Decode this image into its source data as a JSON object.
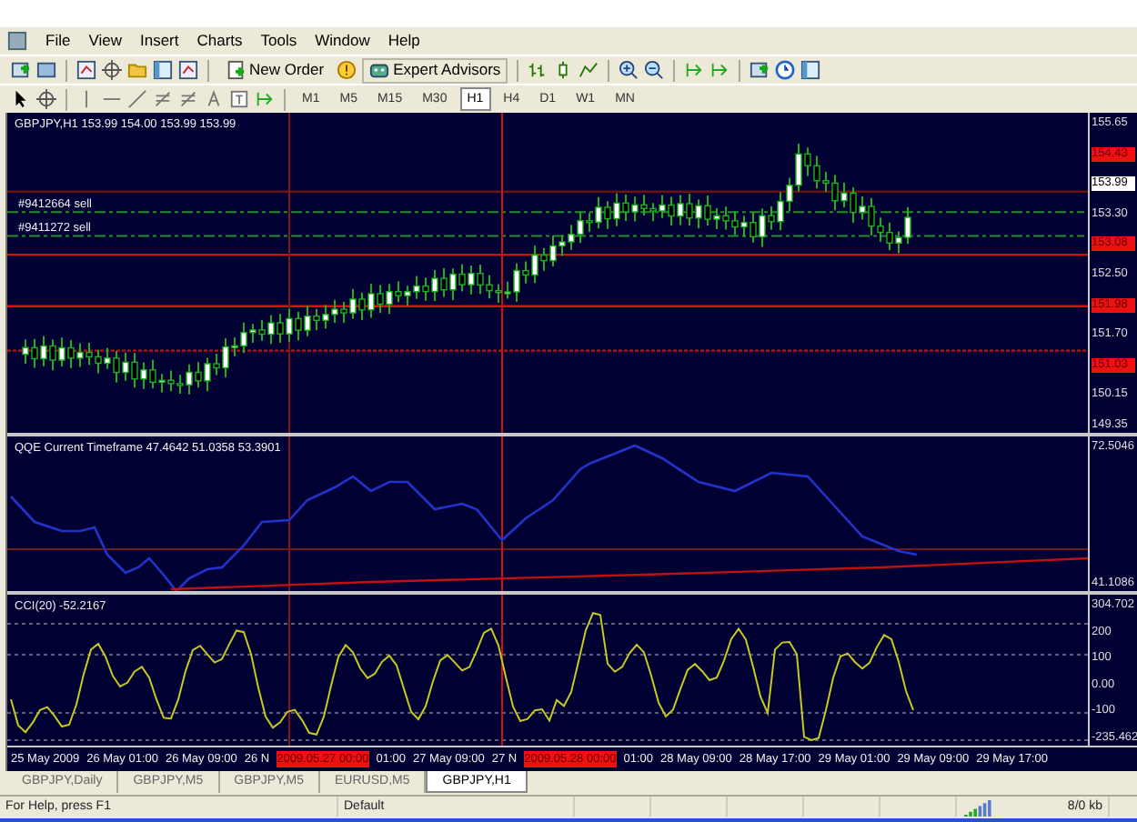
{
  "menu": [
    "File",
    "View",
    "Insert",
    "Charts",
    "Tools",
    "Window",
    "Help"
  ],
  "toolbar": {
    "buttons": [
      {
        "label": "New Order"
      },
      {
        "label": "Expert Advisors"
      }
    ]
  },
  "timeframes": [
    {
      "label": "M1",
      "selected": false
    },
    {
      "label": "M5",
      "selected": false
    },
    {
      "label": "M15",
      "selected": false
    },
    {
      "label": "M30",
      "selected": false
    },
    {
      "label": "H1",
      "selected": true
    },
    {
      "label": "H4",
      "selected": false
    },
    {
      "label": "D1",
      "selected": false
    },
    {
      "label": "W1",
      "selected": false
    },
    {
      "label": "MN",
      "selected": false
    }
  ],
  "main_chart": {
    "title": "GBPJPY,H1 153.99 154.00 153.99 153.99",
    "orders": [
      "#9412664 sell",
      "#9411272 sell"
    ],
    "price_labels": [
      {
        "text": "155.65",
        "kind": "tick"
      },
      {
        "text": "154.43",
        "kind": "level"
      },
      {
        "text": "153.99",
        "kind": "current"
      },
      {
        "text": "153.30",
        "kind": "tick"
      },
      {
        "text": "153.08",
        "kind": "level"
      },
      {
        "text": "152.50",
        "kind": "tick"
      },
      {
        "text": "151.98",
        "kind": "level"
      },
      {
        "text": "151.70",
        "kind": "tick"
      },
      {
        "text": "151.03",
        "kind": "level"
      },
      {
        "text": "150.15",
        "kind": "tick"
      },
      {
        "text": "149.35",
        "kind": "tick"
      }
    ]
  },
  "qqe_chart": {
    "title": "QQE Current Timeframe 47.4642 51.0358 53.3901",
    "scale_labels": [
      "72.5046",
      "41.1086"
    ]
  },
  "cci_chart": {
    "title": "CCI(20) -52.2167",
    "scale_labels": [
      "304.702",
      "200",
      "100",
      "0.00",
      "-100",
      "-235.462"
    ]
  },
  "time_axis": [
    {
      "text": "25 May 2009",
      "highlighted": false
    },
    {
      "text": "26 May 01:00",
      "highlighted": false
    },
    {
      "text": "26 May 09:00",
      "highlighted": false
    },
    {
      "text": "26 N",
      "highlighted": false
    },
    {
      "text": "2009.05.27 00:00",
      "highlighted": true
    },
    {
      "text": "01:00",
      "highlighted": false
    },
    {
      "text": "27 May 09:00",
      "highlighted": false
    },
    {
      "text": "27 N",
      "highlighted": false
    },
    {
      "text": "2009.05.28 00:00",
      "highlighted": true
    },
    {
      "text": "01:00",
      "highlighted": false
    },
    {
      "text": "28 May 09:00",
      "highlighted": false
    },
    {
      "text": "28 May 17:00",
      "highlighted": false
    },
    {
      "text": "29 May 01:00",
      "highlighted": false
    },
    {
      "text": "29 May 09:00",
      "highlighted": false
    },
    {
      "text": "29 May 17:00",
      "highlighted": false
    }
  ],
  "chart_tabs": [
    {
      "label": "GBPJPY,Daily",
      "selected": false
    },
    {
      "label": "GBPJPY,M5",
      "selected": false
    },
    {
      "label": "GBPJPY,M5",
      "selected": false
    },
    {
      "label": "EURUSD,M5",
      "selected": false
    },
    {
      "label": "GBPJPY,H1",
      "selected": true
    }
  ],
  "status_bar": {
    "help": "For Help, press F1",
    "profile": "Default",
    "traffic": "8/0 kb"
  }
}
